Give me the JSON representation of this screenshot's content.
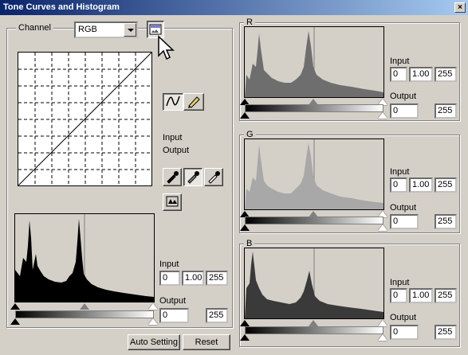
{
  "window": {
    "title": "Tone Curves and Histogram",
    "close_glyph": "×"
  },
  "channel": {
    "label": "Channel",
    "selected": "RGB"
  },
  "tools": {
    "curve_tool": "curve-icon",
    "pencil_tool": "pencil-icon",
    "black_eyedropper": "black-eyedropper-icon",
    "gray_eyedropper": "gray-eyedropper-icon",
    "white_eyedropper": "white-eyedropper-icon",
    "auto_levels": "auto-levels-icon"
  },
  "readout": {
    "input_label": "Input",
    "output_label": "Output"
  },
  "main_levels": {
    "input_label": "Input",
    "in_black": "0",
    "in_gamma": "1.00",
    "in_white": "255",
    "output_label": "Output",
    "out_black": "0",
    "out_white": "255"
  },
  "r_panel": {
    "label": "R",
    "color": "#6e6e6e",
    "input_label": "Input",
    "in_black": "0",
    "in_gamma": "1.00",
    "in_white": "255",
    "output_label": "Output",
    "out_black": "0",
    "out_white": "255"
  },
  "g_panel": {
    "label": "G",
    "color": "#a8a8a8",
    "input_label": "Input",
    "in_black": "0",
    "in_gamma": "1.00",
    "in_white": "255",
    "output_label": "Output",
    "out_black": "0",
    "out_white": "255"
  },
  "b_panel": {
    "label": "B",
    "color": "#3a3a3a",
    "input_label": "Input",
    "in_black": "0",
    "in_gamma": "1.00",
    "in_white": "255",
    "output_label": "Output",
    "out_black": "0",
    "out_white": "255"
  },
  "buttons": {
    "auto_setting": "Auto Setting",
    "reset": "Reset"
  }
}
